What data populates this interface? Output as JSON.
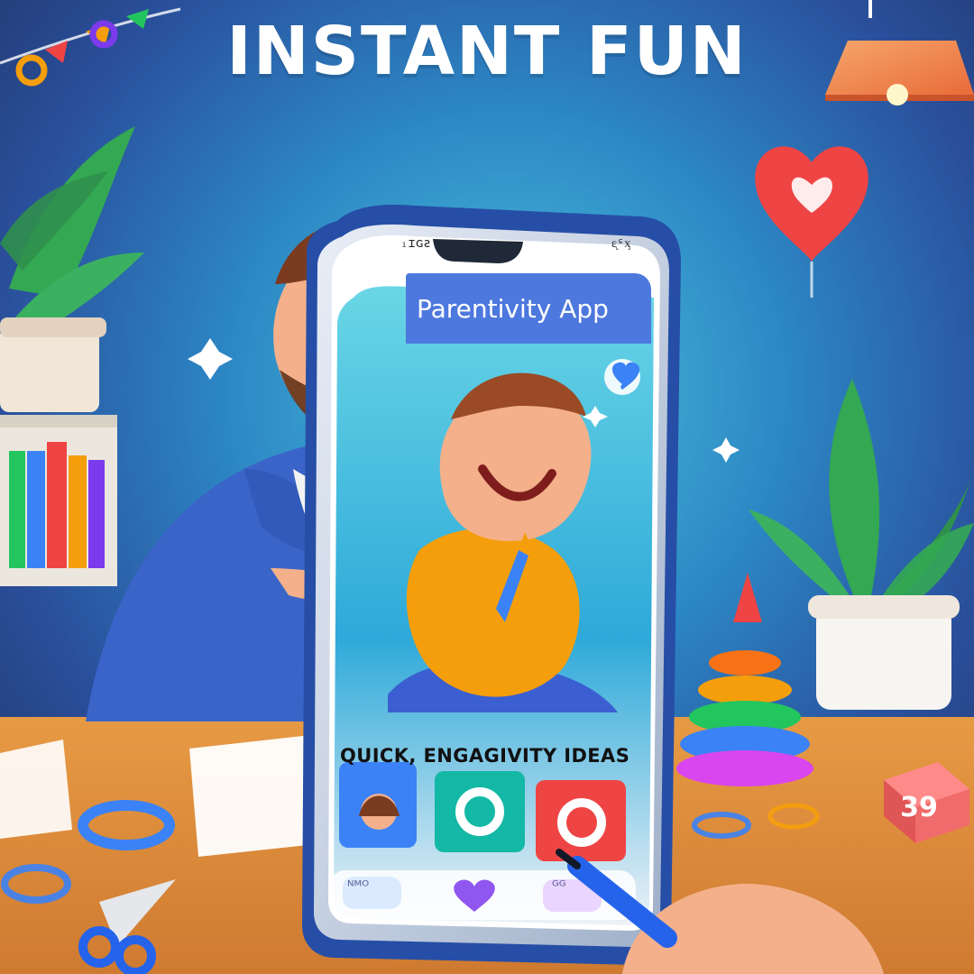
{
  "headline": "INSTANT FUN",
  "app": {
    "title": "Parentivity App",
    "status_left": "ᵢɪɢƨ",
    "status_right": "ᶓᶝᶍ",
    "tagline": "QUICK, ENGAGIVITY IDEAS",
    "nav": [
      "ᴺᴹᴼ",
      "ᴳᴳ"
    ]
  },
  "tag": "39",
  "colors": {
    "primary": "#4d78de",
    "accent": "#f59e0b",
    "danger": "#ef4444"
  },
  "icons": [
    "heart-icon",
    "sparkle-icon"
  ]
}
